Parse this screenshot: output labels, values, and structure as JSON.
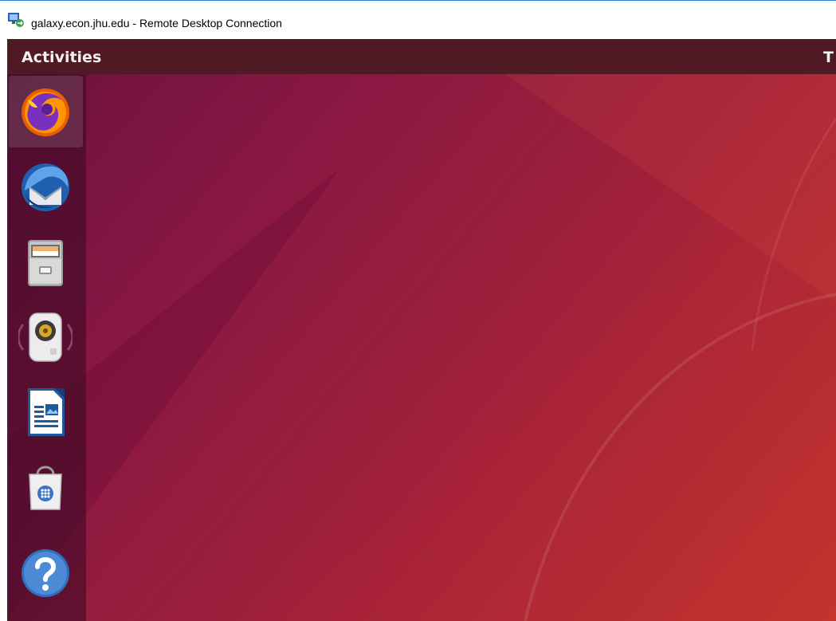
{
  "window": {
    "title": "galaxy.econ.jhu.edu - Remote Desktop Connection",
    "icon": "remote-desktop-icon"
  },
  "topbar": {
    "activities_label": "Activities",
    "clock_partial": "T"
  },
  "dock": {
    "items": [
      {
        "name": "firefox",
        "icon": "firefox-icon",
        "active": true
      },
      {
        "name": "thunderbird",
        "icon": "thunderbird-icon",
        "active": false
      },
      {
        "name": "files",
        "icon": "file-cabinet-icon",
        "active": false
      },
      {
        "name": "rhythmbox",
        "icon": "speaker-icon",
        "active": false
      },
      {
        "name": "libreoffice-writer",
        "icon": "writer-document-icon",
        "active": false
      },
      {
        "name": "software",
        "icon": "shopping-bag-icon",
        "active": false
      },
      {
        "name": "help",
        "icon": "help-icon",
        "active": false
      }
    ]
  },
  "colors": {
    "titlebar_border": "#1f7fd1",
    "topbar_bg": "#4f1a23",
    "wallpaper_start": "#6a1040",
    "wallpaper_end": "#c6362d"
  }
}
